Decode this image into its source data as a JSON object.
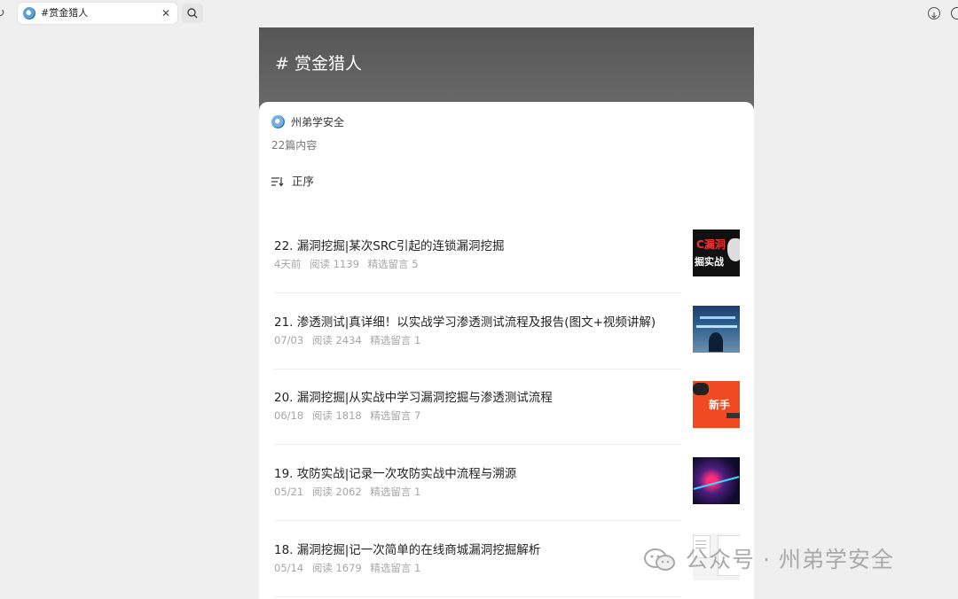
{
  "browser": {
    "tab_title": "#赏金猎人",
    "close_glyph": "✕"
  },
  "header": {
    "title": "# 赏金猎人"
  },
  "account": {
    "name": "州弟学安全",
    "count": "22篇内容"
  },
  "sort": {
    "label": "正序"
  },
  "thumb_text": {
    "t1a": "C漏洞",
    "t1b": "掘实战",
    "t3": "新手"
  },
  "articles": [
    {
      "title": "22. 漏洞挖掘|某次SRC引起的连锁漏洞挖掘",
      "date": "4天前",
      "reads": "阅读 1139",
      "comments": "精选留言 5"
    },
    {
      "title": "21. 渗透测试|真详细！以实战学习渗透测试流程及报告(图文+视频讲解)",
      "date": "07/03",
      "reads": "阅读 2434",
      "comments": "精选留言 1"
    },
    {
      "title": "20. 漏洞挖掘|从实战中学习漏洞挖掘与渗透测试流程",
      "date": "06/18",
      "reads": "阅读 1818",
      "comments": "精选留言 7"
    },
    {
      "title": "19. 攻防实战|记录一次攻防实战中流程与溯源",
      "date": "05/21",
      "reads": "阅读 2062",
      "comments": "精选留言 1"
    },
    {
      "title": "18. 漏洞挖掘|记一次简单的在线商城漏洞挖掘解析",
      "date": "05/14",
      "reads": "阅读 1679",
      "comments": "精选留言 1"
    }
  ],
  "watermark": {
    "text": "公众号 · 州弟学安全"
  }
}
